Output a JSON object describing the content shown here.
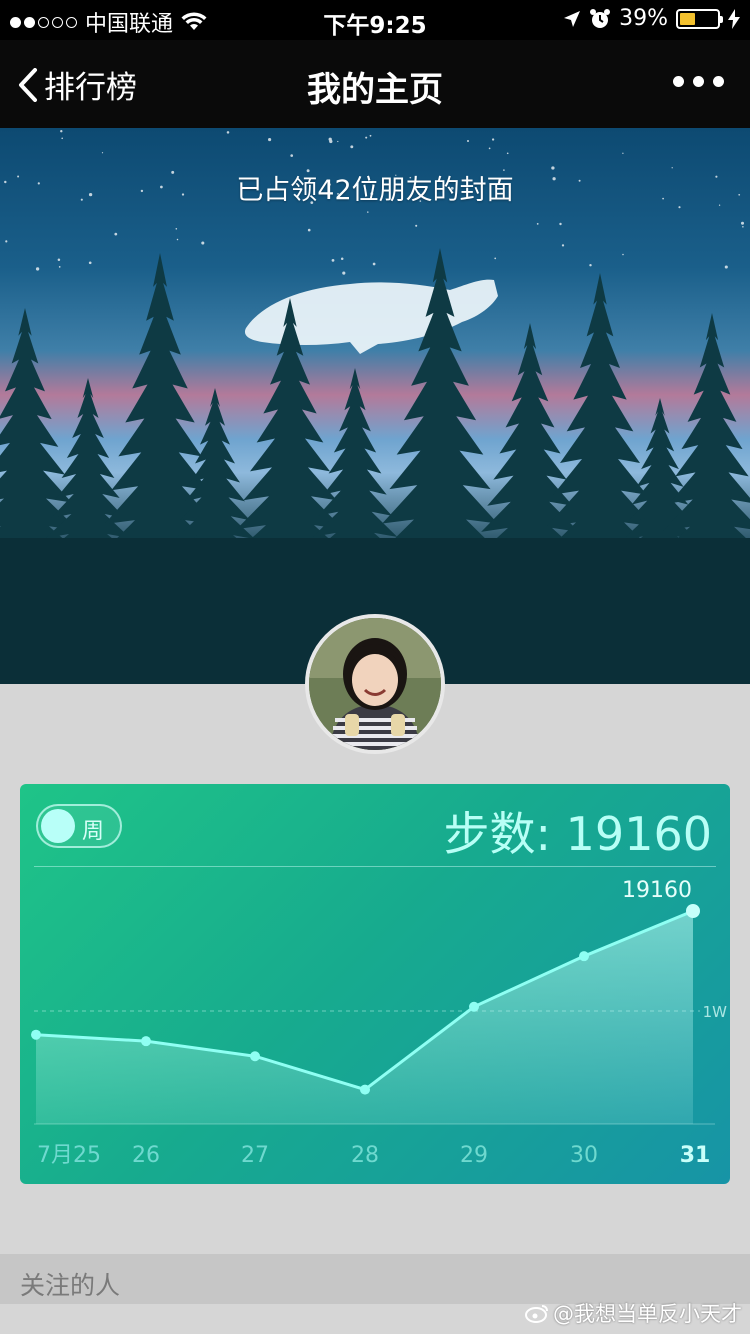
{
  "status_bar": {
    "carrier": "中国联通",
    "time": "下午9:25",
    "battery_percent": "39%",
    "battery_level": 0.39,
    "signal_bars_filled": 2,
    "signal_bars_total": 5
  },
  "nav": {
    "back_label": "排行榜",
    "title": "我的主页"
  },
  "cover": {
    "text": "已占领42位朋友的封面"
  },
  "card": {
    "toggle_label": "周",
    "steps_label": "步数: 19160"
  },
  "chart_data": {
    "type": "area",
    "categories": [
      "7月25",
      "26",
      "27",
      "28",
      "29",
      "30",
      "31"
    ],
    "values": [
      4150,
      3850,
      3150,
      1600,
      5450,
      7800,
      9900
    ],
    "peak_label": "19160",
    "reference_label": "1W",
    "reference_value": 5250,
    "highlight_category": "31",
    "colors": {
      "line": "#8ffff3",
      "fill": "rgba(170,255,248,0.35)",
      "tick": "#6fd9cf",
      "tick_active": "#c9fffa"
    }
  },
  "section": {
    "title": "关注的人"
  },
  "watermark": "@我想当单反小天才"
}
